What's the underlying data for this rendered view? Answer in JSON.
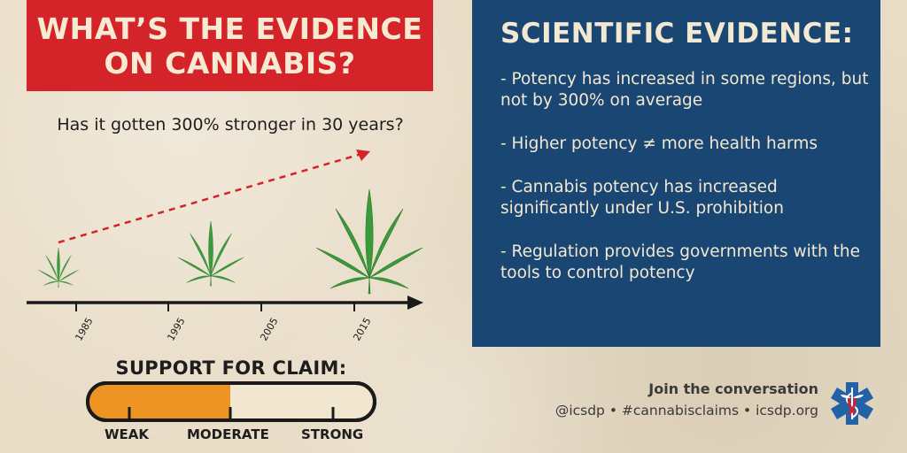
{
  "header": {
    "title_line1": "WHAT’S THE EVIDENCE",
    "title_line2": "ON CANNABIS?"
  },
  "question": "Has it gotten 300% stronger in 30 years?",
  "timeline": {
    "years": [
      "1985",
      "1995",
      "2005",
      "2015"
    ]
  },
  "evidence": {
    "title": "SCIENTIFIC EVIDENCE:",
    "items": [
      "- Potency has increased in some regions, but not by 300% on average",
      "- Higher potency ≠ more health harms",
      "- Cannabis potency has increased significantly under U.S. prohibition",
      "- Regulation provides governments with the tools to control potency"
    ]
  },
  "support": {
    "label": "SUPPORT FOR CLAIM:",
    "levels": [
      "WEAK",
      "MODERATE",
      "STRONG"
    ],
    "level_value": "MODERATE"
  },
  "footer": {
    "join_title": "Join the conversation",
    "links": "@icsdp • #cannabisclaims • icsdp.org"
  },
  "colors": {
    "title_red": "#d5232a",
    "panel_blue": "#1a4673",
    "leaf_green": "#3b9a3a",
    "gauge_orange": "#ee9422",
    "arrow_red": "#d5232a"
  }
}
